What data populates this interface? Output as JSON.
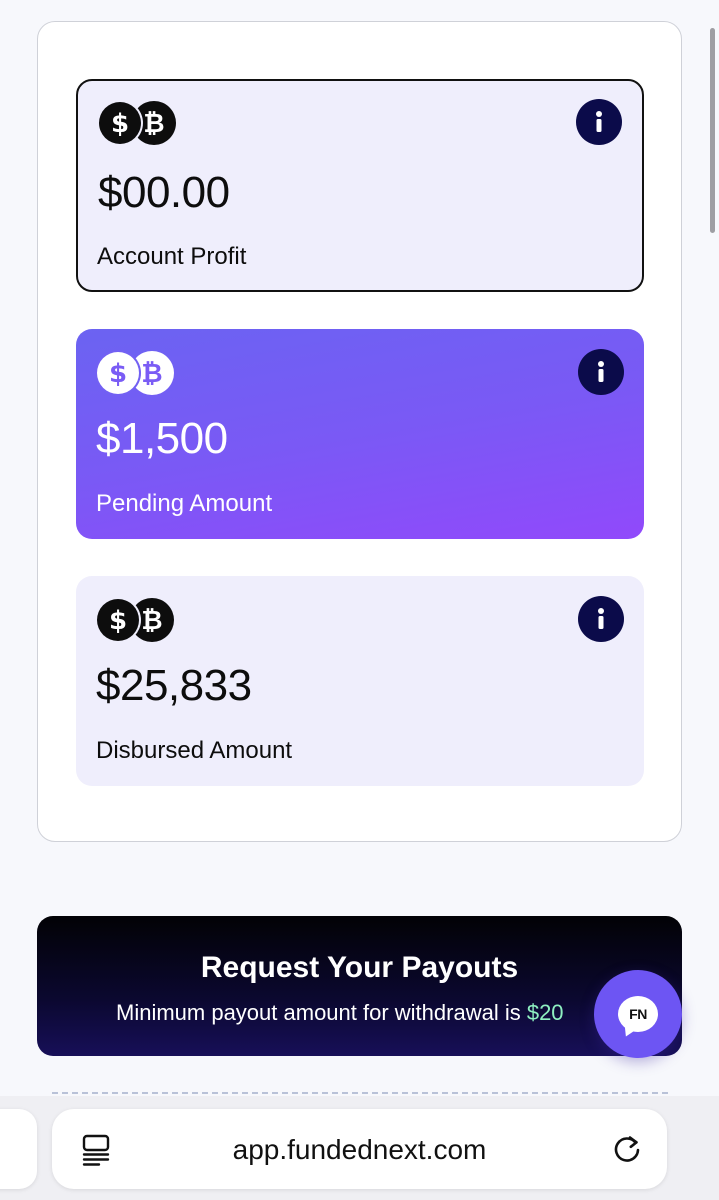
{
  "cards": [
    {
      "amount": "$00.00",
      "label": "Account Profit"
    },
    {
      "amount": "$1,500",
      "label": "Pending Amount"
    },
    {
      "amount": "$25,833",
      "label": "Disbursed Amount"
    }
  ],
  "payout_banner": {
    "title": "Request Your Payouts",
    "subtitle": "Minimum payout amount for withdrawal is ",
    "subtitle_amount": "$20"
  },
  "chat_button": {
    "logo_text": "FN"
  },
  "browser": {
    "url": "app.fundednext.com"
  },
  "icons": {
    "coins": "dollar-bitcoin-coins-icon",
    "info": "info-icon",
    "chat": "chat-icon",
    "reader": "reader-mode-icon",
    "reload": "reload-icon"
  },
  "colors": {
    "pending_gradient_start": "#6b63f2",
    "pending_gradient_end": "#9149fb",
    "card_background": "#efeefc",
    "info_icon_bg": "#0b0b4a",
    "banner_bg": "#0b0830",
    "accent_green": "#8ef0c1",
    "chat_button": "#6d55f3"
  }
}
